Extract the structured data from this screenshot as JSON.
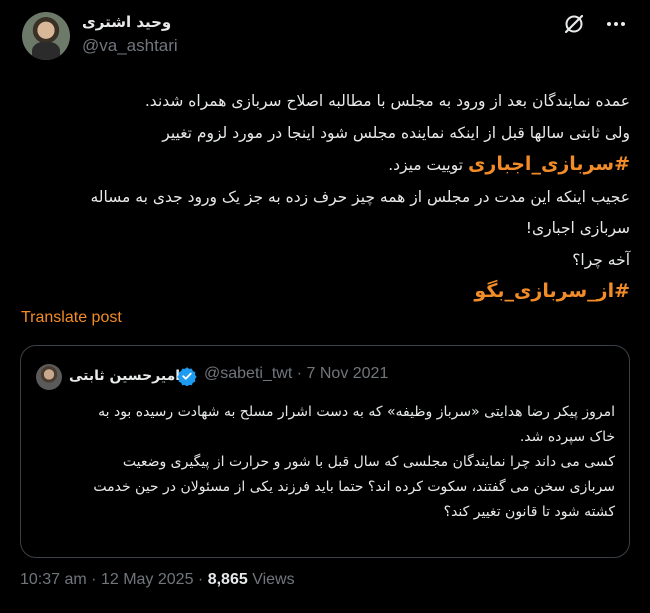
{
  "author": {
    "name": "وحید اشتری",
    "handle": "@va_ashtari"
  },
  "icons": {
    "grok": "grok-icon",
    "more": "more-icon",
    "verified": "verified-badge-icon"
  },
  "tweet": {
    "lines": [
      "عمده نمایندگان بعد از ورود به مجلس با مطالبه اصلاح سربازی همراه شدند.",
      "ولی ثابتی سالها قبل از اینکه نماینده مجلس شود اینجا در مورد لزوم تغییر",
      "عجیب اینکه این مدت در مجلس از همه چیز حرف زده به جز یک ورود جدی به مساله",
      "سربازی اجباری!",
      "آخه چرا؟"
    ],
    "hashtag1": "#سربازی_اجباری",
    "after_hashtag1": " توییت میزد.",
    "hashtag2": "#از_سربازی_بگو"
  },
  "translate_label": "Translate post",
  "quote": {
    "name": "امیرحسین ثابتی",
    "handle": "@sabeti_twt",
    "separator": "·",
    "date": "7 Nov 2021",
    "lines": [
      "امروز پیکر رضا هدایتی «سرباز وظیفه» که به دست اشرار مسلح به شهادت رسیده بود به",
      "خاک سپرده شد.",
      "کسی می داند چرا نمایندگان مجلسی که سال قبل با شور و حرارت از پیگیری وضعیت",
      "سربازی سخن می گفتند، سکوت کرده اند؟ حتما باید فرزند یکی از مسئولان در حین خدمت",
      "کشته شود تا قانون تغییر کند؟"
    ]
  },
  "footer": {
    "time": "10:37 am",
    "separator": "·",
    "date": "12 May 2025",
    "separator2": "·",
    "views_count": "8,865",
    "views_label": "Views"
  },
  "colors": {
    "background": "#000000",
    "text": "#e7e9ea",
    "muted": "#71767b",
    "accent": "#f28c28",
    "border": "#3b4046",
    "verified": "#1d9bf0"
  }
}
